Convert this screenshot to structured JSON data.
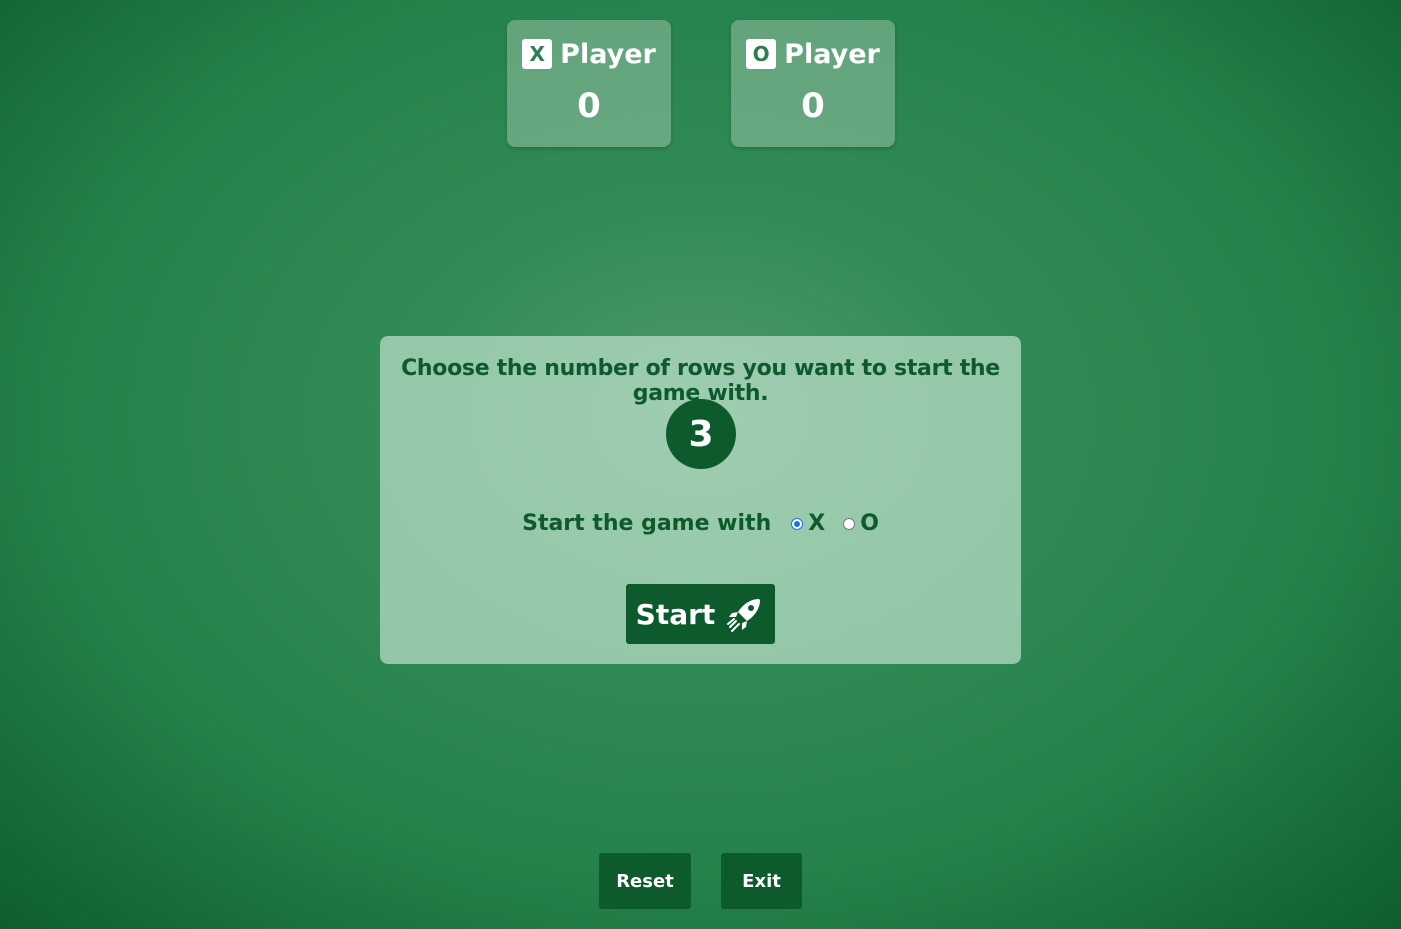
{
  "scoreboard": {
    "x_player": {
      "badge": "X",
      "label": "Player",
      "score": "0"
    },
    "o_player": {
      "badge": "O",
      "label": "Player",
      "score": "0"
    }
  },
  "setup": {
    "prompt": "Choose the number of rows you want to start the game with.",
    "rows_value": "3",
    "start_with_label": "Start the game with",
    "options": [
      {
        "label": "X",
        "selected": true
      },
      {
        "label": "O",
        "selected": false
      }
    ],
    "start_button": {
      "label": "Start",
      "icon": "rocket-icon"
    }
  },
  "footer": {
    "reset_label": "Reset",
    "exit_label": "Exit"
  },
  "colors": {
    "dark_green": "#0d5a2c",
    "radio_accent": "#1a73e8"
  }
}
